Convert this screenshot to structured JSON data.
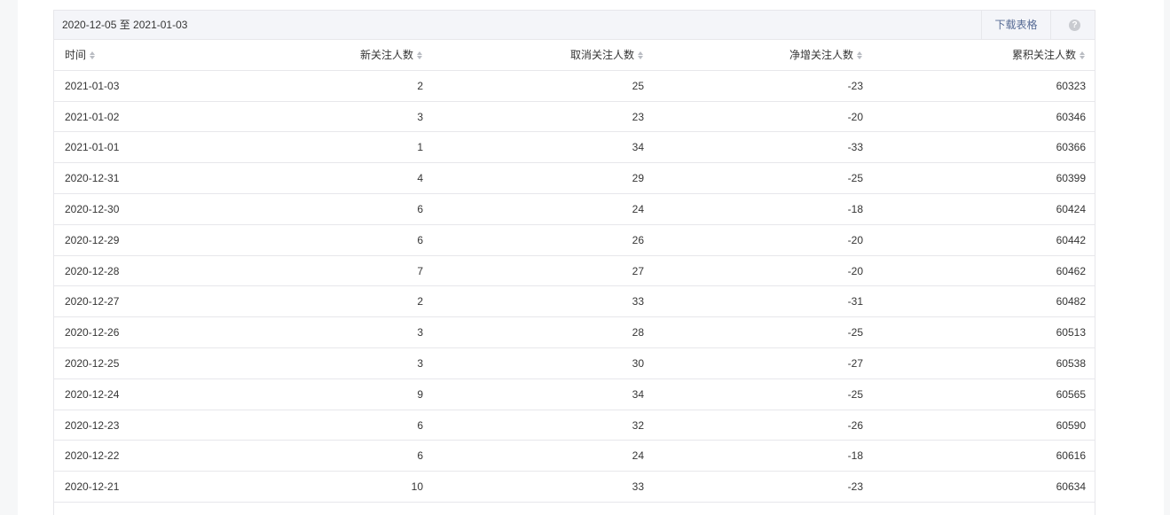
{
  "toolbar": {
    "date_range": "2020-12-05 至 2021-01-03",
    "download_label": "下载表格",
    "help_glyph": "?"
  },
  "columns": [
    "时间",
    "新关注人数",
    "取消关注人数",
    "净增关注人数",
    "累积关注人数"
  ],
  "rows": [
    [
      "2021-01-03",
      "2",
      "25",
      "-23",
      "60323"
    ],
    [
      "2021-01-02",
      "3",
      "23",
      "-20",
      "60346"
    ],
    [
      "2021-01-01",
      "1",
      "34",
      "-33",
      "60366"
    ],
    [
      "2020-12-31",
      "4",
      "29",
      "-25",
      "60399"
    ],
    [
      "2020-12-30",
      "6",
      "24",
      "-18",
      "60424"
    ],
    [
      "2020-12-29",
      "6",
      "26",
      "-20",
      "60442"
    ],
    [
      "2020-12-28",
      "7",
      "27",
      "-20",
      "60462"
    ],
    [
      "2020-12-27",
      "2",
      "33",
      "-31",
      "60482"
    ],
    [
      "2020-12-26",
      "3",
      "28",
      "-25",
      "60513"
    ],
    [
      "2020-12-25",
      "3",
      "30",
      "-27",
      "60538"
    ],
    [
      "2020-12-24",
      "9",
      "34",
      "-25",
      "60565"
    ],
    [
      "2020-12-23",
      "6",
      "32",
      "-26",
      "60590"
    ],
    [
      "2020-12-22",
      "6",
      "24",
      "-18",
      "60616"
    ],
    [
      "2020-12-21",
      "10",
      "33",
      "-23",
      "60634"
    ]
  ],
  "colors": {
    "link": "#576b95",
    "toolbar_bg": "#f4f5f9",
    "border": "#e7e7eb"
  }
}
